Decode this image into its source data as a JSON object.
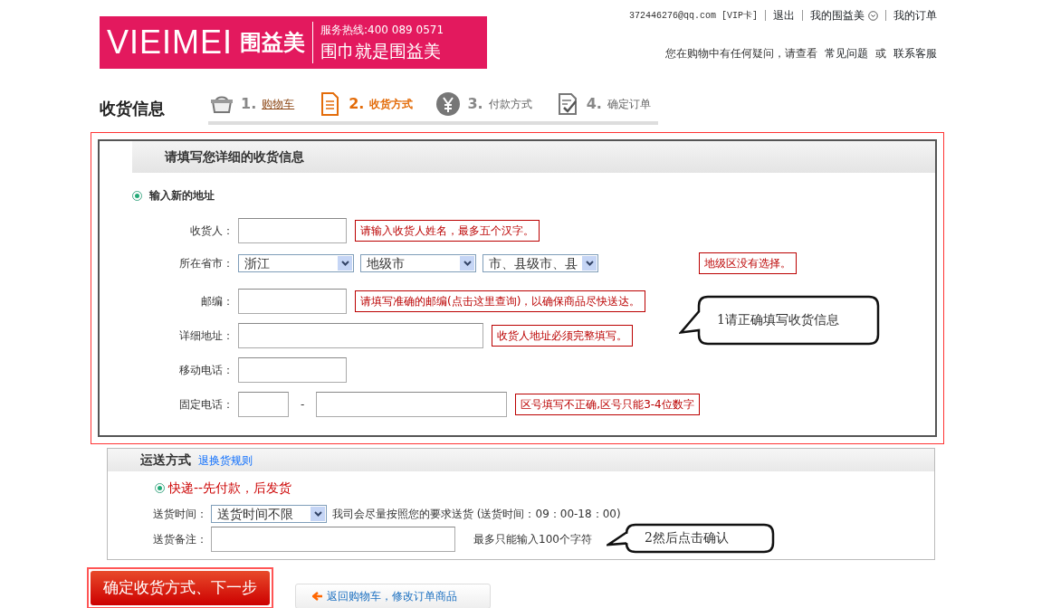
{
  "header": {
    "logo": {
      "brand": "VIEIMEI",
      "name": "围益美",
      "hotline": "服务热线:400 089 0571",
      "slogan": "围巾就是围益美"
    },
    "account_links": [
      {
        "text": "372446276@qq.com [VIP卡]",
        "kind": "text"
      },
      {
        "text": "退出",
        "kind": "link"
      },
      {
        "text": "我的围益美",
        "kind": "dropdown"
      },
      {
        "text": "我的订单",
        "kind": "link"
      }
    ],
    "help": {
      "text": "您在购物中有任何疑问，请查看",
      "links": [
        "常见问题",
        "联系客服"
      ],
      "joiner": "或"
    }
  },
  "page_title": "收货信息",
  "steps": [
    {
      "number": "1.",
      "label": "购物车",
      "kind": "done"
    },
    {
      "number": "2.",
      "label": "收货方式",
      "kind": "current"
    },
    {
      "number": "3.",
      "label": "付款方式",
      "kind": "pending"
    },
    {
      "number": "4.",
      "label": "确定订单",
      "kind": "pending"
    }
  ],
  "address": {
    "title": "请填写您详细的收货信息",
    "option": {
      "label": "输入新的地址",
      "selected": true
    },
    "fields": [
      {
        "kind": "text",
        "label": "收货人：",
        "hint": [
          "请输入收货人姓名，最多五个汉字。"
        ]
      },
      {
        "kind": "region",
        "label": "所在省市：",
        "selects": [
          "浙江",
          "地级市",
          "市、县级市、县"
        ],
        "hint": [
          "地级区没有选择。"
        ]
      },
      {
        "kind": "text",
        "label": "邮编：",
        "hint": [
          "请填写准确的",
          {
            "link": "邮编(点击这里查询)"
          },
          "，以确保商品尽快送达。"
        ]
      },
      {
        "kind": "text",
        "label": "详细地址：",
        "hint": [
          "收货人地址必须完整填写。"
        ]
      },
      {
        "kind": "text",
        "label": "移动电话："
      },
      {
        "kind": "phone",
        "label": "固定电话：",
        "separator": "-",
        "hint": [
          "区号填写不正确,区号只能3-4位数字"
        ]
      }
    ]
  },
  "callouts": [
    "1请正确填写收货信息",
    "2然后点击确认"
  ],
  "shipping": {
    "title": "运送方式",
    "link": "退换货规则",
    "option": {
      "label": "快递--先付款，后发货",
      "selected": true
    },
    "time_label": "送货时间：",
    "time_value": "送货时间不限",
    "time_note": "我司会尽量按照您的要求送货 (送货时间：09：00-18：00)",
    "remark_label": "送货备注：",
    "remark_note": "最多只能输入100个字符"
  },
  "buttons": {
    "confirm": "确定收货方式、下一步",
    "back": "返回购物车，修改订单商品"
  }
}
